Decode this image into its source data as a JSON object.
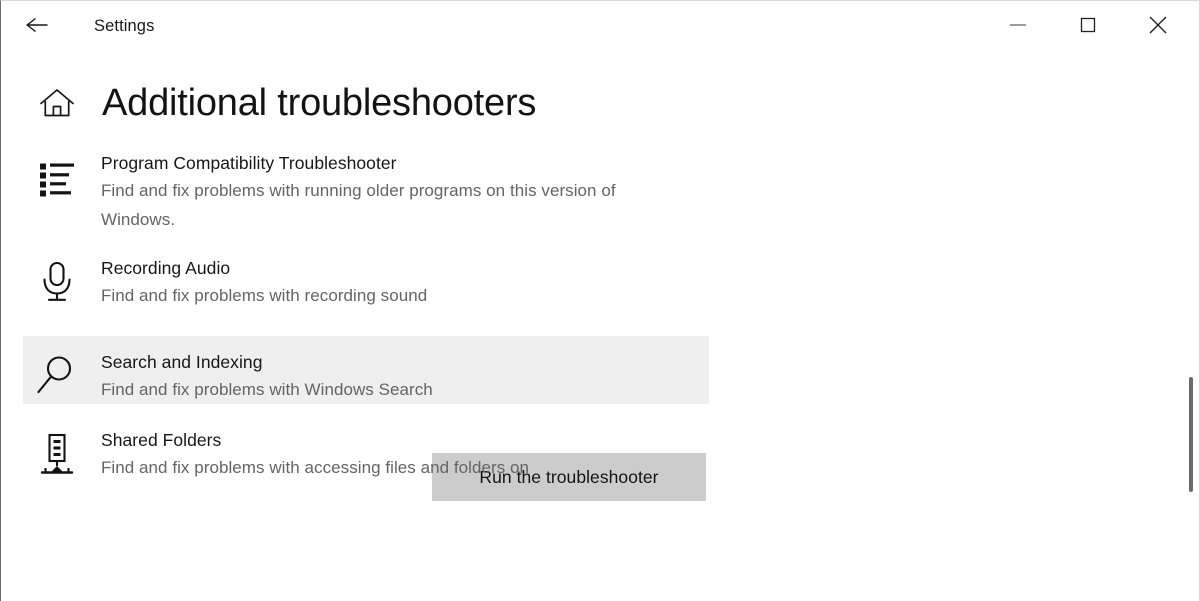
{
  "window": {
    "title": "Settings",
    "back_icon": "back-arrow-icon",
    "controls": {
      "minimize": "minimize-icon",
      "maximize": "maximize-icon",
      "close": "close-icon"
    }
  },
  "page": {
    "home_icon": "home-icon",
    "title": "Additional troubleshooters"
  },
  "troubleshooters": [
    {
      "icon": "list-icon",
      "title": "Program Compatibility Troubleshooter",
      "description": "Find and fix problems with running older programs on this version of Windows.",
      "selected": false
    },
    {
      "icon": "microphone-icon",
      "title": "Recording Audio",
      "description": "Find and fix problems with recording sound",
      "selected": false
    },
    {
      "icon": "search-icon",
      "title": "Search and Indexing",
      "description": "Find and fix problems with Windows Search",
      "selected": true,
      "action_label": "Run the troubleshooter"
    },
    {
      "icon": "server-icon",
      "title": "Shared Folders",
      "description": "Find and fix problems with accessing files and folders on",
      "selected": false
    }
  ],
  "colors": {
    "selected_background": "#efefef",
    "button_background": "#cccccc",
    "description_text": "#646464",
    "scrollbar_thumb": "#6b6b6b"
  }
}
